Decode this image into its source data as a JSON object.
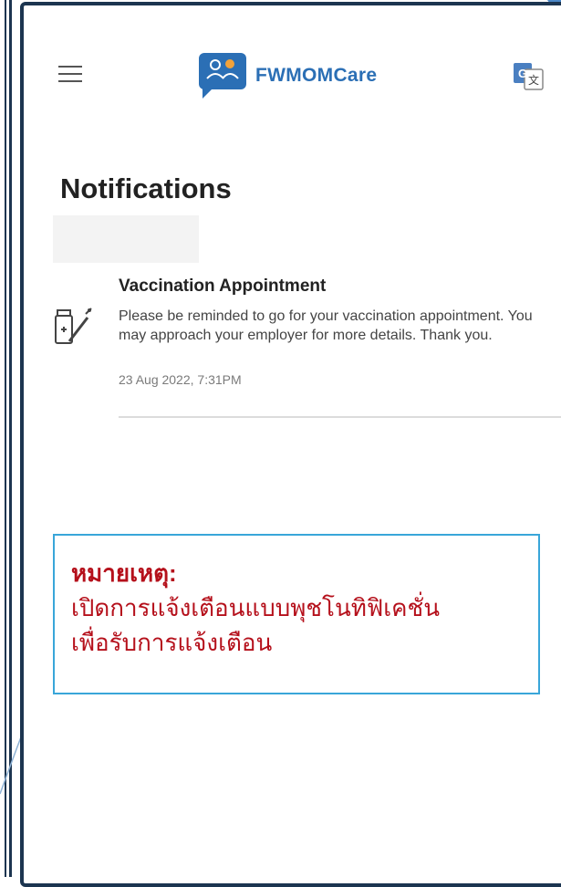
{
  "header": {
    "app_name": "FWMOMCare",
    "menu_icon": "hamburger-menu-icon",
    "logo_icon": "fwmomcare-logo-icon",
    "translate_icon": "google-translate-icon"
  },
  "page": {
    "title": "Notifications"
  },
  "notifications": [
    {
      "title": "Vaccination Appointment",
      "body": "Please be reminded to go for your vaccination appointment. You may approach your employer for more details. Thank you.",
      "time": "23 Aug 2022, 7:31PM",
      "icon": "vaccine-syringe-icon"
    }
  ],
  "note": {
    "heading": "หมายเหตุ:",
    "line1": "เปิดการแจ้งเตือนแบบพุชโนทิฟิเคชั่น",
    "line2": "เพื่อรับการแจ้งเตือน"
  },
  "colors": {
    "brand": "#2b6fb5",
    "frame": "#1c3550",
    "note_text": "#b5101b",
    "note_border": "#39a6d9"
  }
}
